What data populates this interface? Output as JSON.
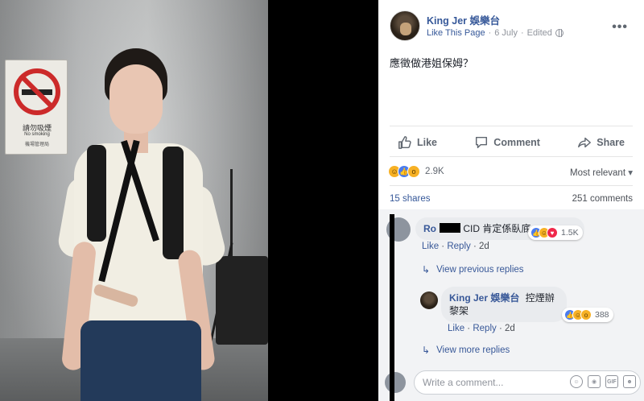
{
  "photo": {
    "sign_title": "請勿吸煙",
    "sign_subtitle": "No smoking",
    "sign_footer": "機場管理局"
  },
  "post": {
    "page_name": "King Jer 娛樂台",
    "like_page": "Like This Page",
    "date": "6 July",
    "edited": "Edited",
    "text": "應徵做港姐保姆？",
    "more_icon": "more-options-icon",
    "actions": {
      "like": "Like",
      "comment": "Comment",
      "share": "Share"
    },
    "reactions_count": "2.9K",
    "sort": "Most relevant",
    "shares": "15 shares",
    "comments_count": "251 comments"
  },
  "comments": [
    {
      "author": "Ro",
      "text": "CID 肯定係臥底",
      "reactions": "1.5K",
      "like": "Like",
      "reply": "Reply",
      "age": "2d"
    }
  ],
  "view_previous": "View previous replies",
  "reply": {
    "author": "King Jer 娛樂台",
    "text": "控煙辦黎架",
    "reactions": "388",
    "like": "Like",
    "reply": "Reply",
    "age": "2d"
  },
  "view_more": "View more replies",
  "composer": {
    "placeholder": "Write a comment...",
    "gif": "GIF"
  },
  "colors": {
    "link": "#365899",
    "like_blue": "#4a7cf0",
    "haha_yellow": "#f7b125",
    "love_red": "#f0284a"
  }
}
